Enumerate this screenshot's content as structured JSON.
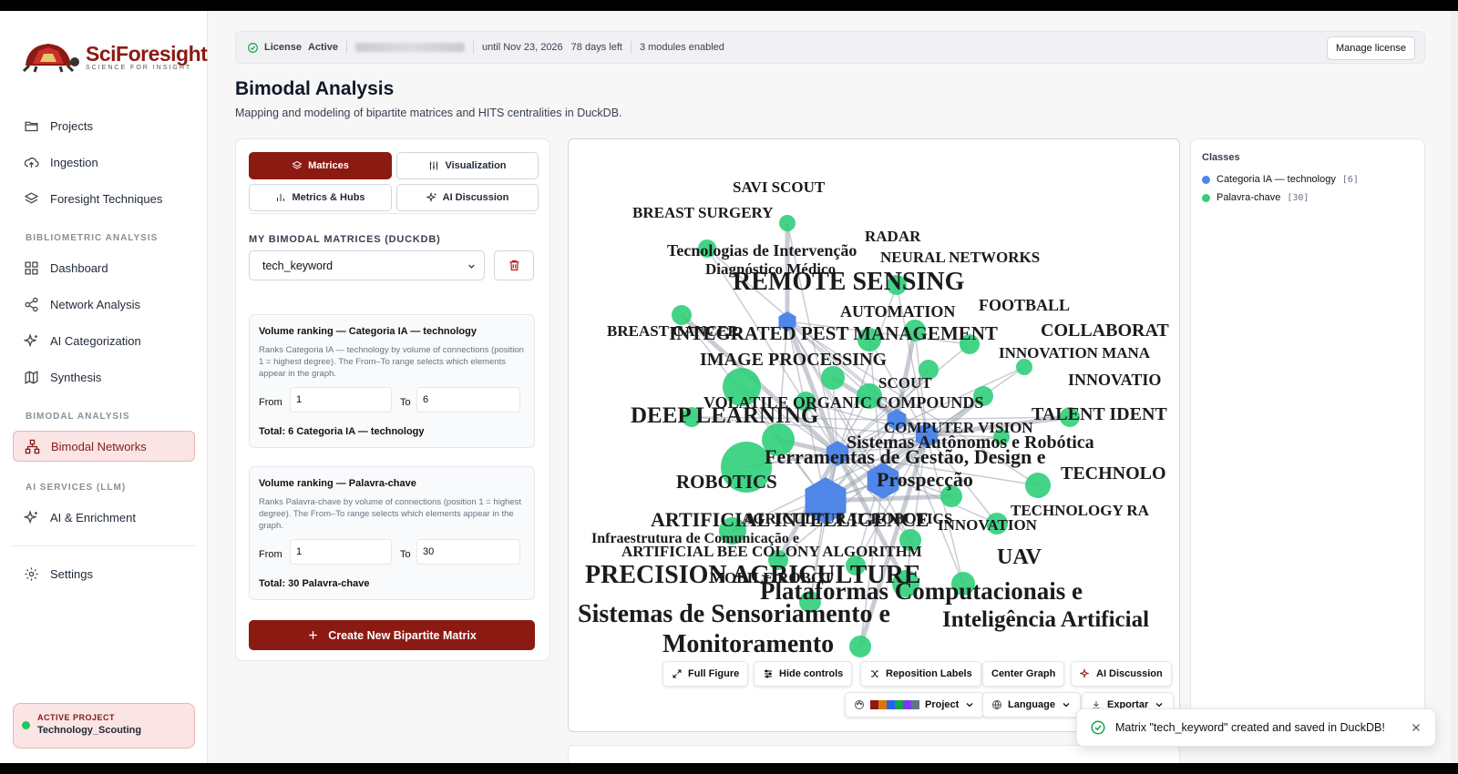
{
  "brand": {
    "name": "SciForesight",
    "tagline": "SCIENCE FOR INSIGHT",
    "accent": "#8b1a13"
  },
  "sidebar": {
    "items": [
      {
        "label": "Projects",
        "icon": "folder-icon"
      },
      {
        "label": "Ingestion",
        "icon": "cloud-upload-icon"
      },
      {
        "label": "Foresight Techniques",
        "icon": "layers-icon"
      }
    ],
    "sections": [
      {
        "label": "BIBLIOMETRIC ANALYSIS",
        "items": [
          {
            "label": "Dashboard",
            "icon": "dashboard-icon"
          },
          {
            "label": "Network Analysis",
            "icon": "share-icon"
          },
          {
            "label": "AI Categorization",
            "icon": "sparkles-icon"
          },
          {
            "label": "Synthesis",
            "icon": "map-icon"
          }
        ]
      },
      {
        "label": "BIMODAL ANALYSIS",
        "items": [
          {
            "label": "Bimodal Networks",
            "icon": "network-icon"
          }
        ]
      },
      {
        "label": "AI SERVICES (LLM)",
        "items": [
          {
            "label": "AI & Enrichment",
            "icon": "sparkles-icon"
          }
        ]
      }
    ],
    "settings": "Settings",
    "active_project": {
      "label": "ACTIVE PROJECT",
      "name": "Technology_Scouting"
    }
  },
  "license": {
    "label": "License",
    "status": "Active",
    "expiry": "until Nov 23, 2026",
    "days_left": "78 days left",
    "modules": "3 modules enabled",
    "manage": "Manage license"
  },
  "page": {
    "title": "Bimodal Analysis",
    "subtitle": "Mapping and modeling of bipartite matrices and HITS centralities in DuckDB."
  },
  "tabs": [
    {
      "label": "Matrices",
      "icon": "layers-icon",
      "active": true
    },
    {
      "label": "Visualization",
      "icon": "sliders-icon",
      "active": false
    },
    {
      "label": "Metrics & Hubs",
      "icon": "bar-chart-icon",
      "active": false
    },
    {
      "label": "AI Discussion",
      "icon": "sparkles-icon",
      "active": false
    }
  ],
  "matrices": {
    "label": "MY BIMODAL MATRICES (DUCKDB)",
    "selected": "tech_keyword",
    "rankings": [
      {
        "title": "Volume ranking — Categoria IA — technology",
        "desc": "Ranks Categoria IA — technology by volume of connections (position 1 = highest degree). The From–To range selects which elements appear in the graph.",
        "from_label": "From",
        "from": "1",
        "to_label": "To",
        "to": "6",
        "total": "Total: 6 Categoria IA — technology"
      },
      {
        "title": "Volume ranking — Palavra-chave",
        "desc": "Ranks Palavra-chave by volume of connections (position 1 = highest degree). The From–To range selects which elements appear in the graph.",
        "from_label": "From",
        "from": "1",
        "to_label": "To",
        "to": "30",
        "total": "Total: 30 Palavra-chave"
      }
    ],
    "create": "Create New Bipartite Matrix"
  },
  "graph": {
    "labels": [
      "SAVI SCOUT",
      "BREAST SURGERY",
      "RADAR",
      "Tecnologias de Intervenção",
      "NEURAL NETWORKS",
      "Diagnóstico Médico",
      "REMOTE SENSING",
      "AUTOMATION",
      "FOOTBALL",
      "BREAST CANCER",
      "INTEGRATED PEST MANAGEMENT",
      "COLLABORAT",
      "INNOVATION MANA",
      "IMAGE PROCESSING",
      "INNOVATIO",
      "SCOUT",
      "VOLATILE ORGANIC COMPOUNDS",
      "DEEP LEARNING",
      "TALENT IDENT",
      "COMPUTER VISION",
      "Sistemas Autônomos e Robótica",
      "Ferramentas de Gestão, Design e",
      "ROBOTICS",
      "Prospecção",
      "TECHNOLO",
      "TECHNOLOGY RA",
      "ARTIFICIAL INTELLIGENCE",
      "AGRICULTURAL ROBOTICS",
      "INNOVATION",
      "Infraestrutura de Comunicação e",
      "ARTIFICIAL BEE COLONY ALGORITHM",
      "UAV",
      "PRECISION AGRICULTURE",
      "MOBILE ROBOT",
      "Plataformas Computacionais e",
      "Sistemas de Sensoriamento e",
      "Inteligência Artificial",
      "Monitoramento"
    ],
    "buttons": {
      "full": "Full Figure",
      "hide": "Hide controls",
      "reposition": "Reposition Labels",
      "center": "Center Graph",
      "ai": "AI Discussion",
      "project": "Project",
      "language": "Language",
      "export": "Exportar"
    },
    "colors": {
      "technology": "#4f86e8",
      "keyword": "#2fcf7a",
      "edge": "#9ca3af"
    }
  },
  "classes": {
    "title": "Classes",
    "items": [
      {
        "label": "Categoria IA — technology",
        "count": "[6]",
        "color": "#4f86e8"
      },
      {
        "label": "Palavra-chave",
        "count": "[30]",
        "color": "#2fcf7a"
      }
    ]
  },
  "toast": {
    "message": "Matrix \"tech_keyword\" created and saved in DuckDB!"
  }
}
